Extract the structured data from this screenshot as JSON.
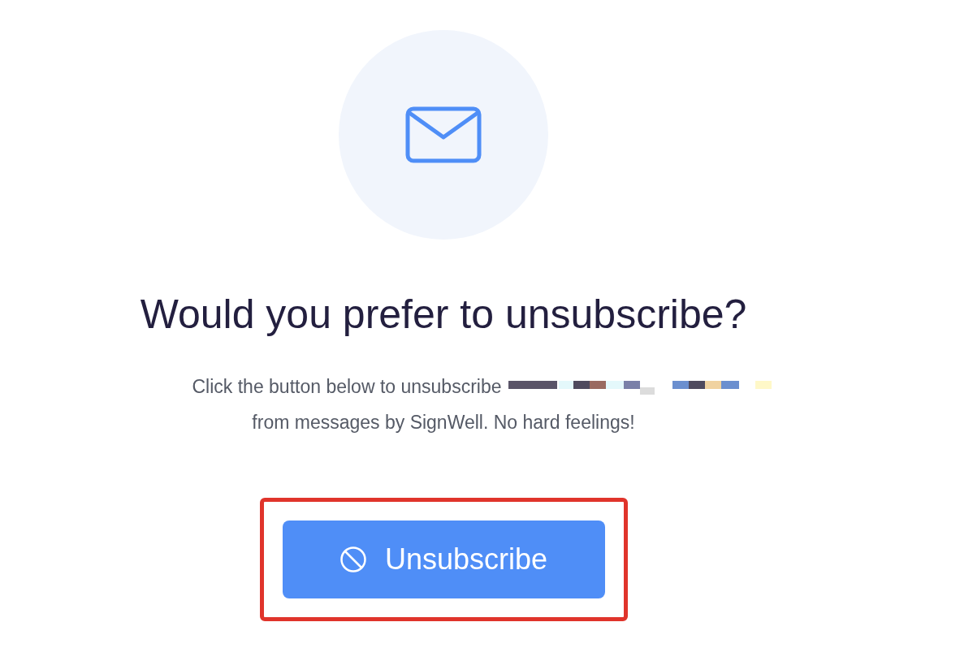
{
  "heading": "Would you prefer to unsubscribe?",
  "message_lines": [
    "Click the button below to unsubscribe",
    "from messages by SignWell. No hard feelings!"
  ],
  "button": {
    "label": "Unsubscribe",
    "highlighted": true
  }
}
